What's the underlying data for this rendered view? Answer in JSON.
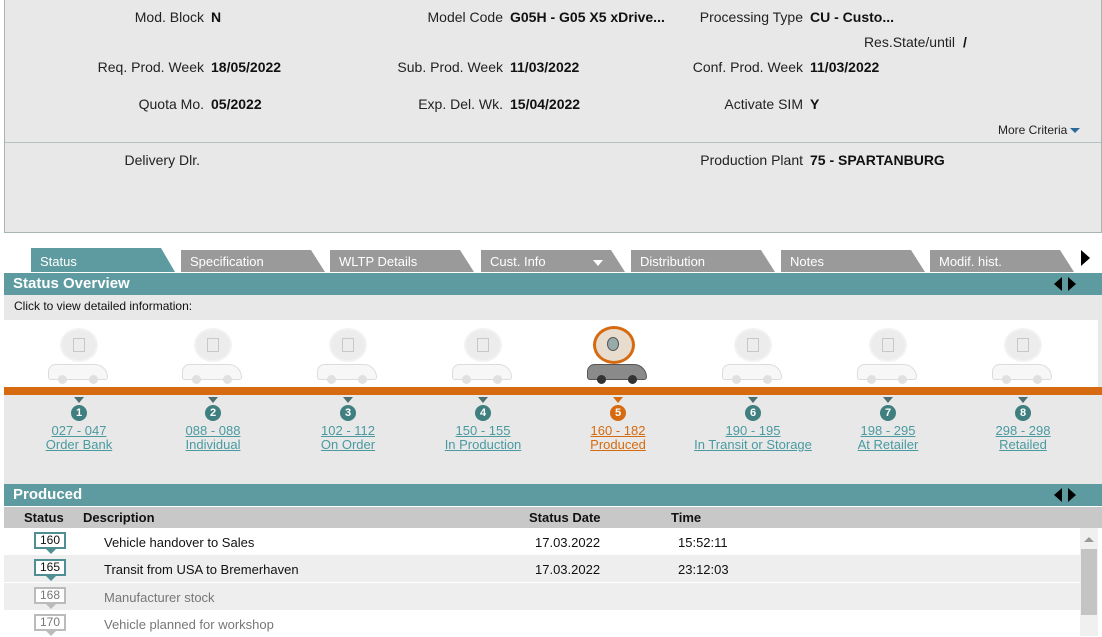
{
  "header": {
    "mod_block": {
      "label": "Mod. Block",
      "value": "N"
    },
    "model_code": {
      "label": "Model Code",
      "value": "G05H - G05 X5 xDrive..."
    },
    "processing_type": {
      "label": "Processing Type",
      "value": "CU - Custo..."
    },
    "res_state": {
      "label": "Res.State/until",
      "value": "/"
    },
    "req_prod_week": {
      "label": "Req. Prod. Week",
      "value": "18/05/2022"
    },
    "sub_prod_week": {
      "label": "Sub. Prod. Week",
      "value": "11/03/2022"
    },
    "conf_prod_week": {
      "label": "Conf. Prod. Week",
      "value": "11/03/2022"
    },
    "quota_mo": {
      "label": "Quota Mo.",
      "value": "05/2022"
    },
    "exp_del_wk": {
      "label": "Exp. Del. Wk.",
      "value": "15/04/2022"
    },
    "activate_sim": {
      "label": "Activate SIM",
      "value": "Y"
    },
    "more_criteria": "More Criteria",
    "delivery_dlr": {
      "label": "Delivery Dlr.",
      "value": ""
    },
    "production_plant": {
      "label": "Production Plant",
      "value": "75 - SPARTANBURG"
    }
  },
  "tabs": [
    {
      "label": "Status",
      "active": true
    },
    {
      "label": "Specification"
    },
    {
      "label": "WLTP Details"
    },
    {
      "label": "Cust. Info",
      "dropdown": true
    },
    {
      "label": "Distribution"
    },
    {
      "label": "Notes"
    },
    {
      "label": "Modif. hist."
    }
  ],
  "status_overview": {
    "title": "Status Overview",
    "hint": "Click to view detailed information:",
    "steps": [
      {
        "num": "1",
        "range": "027 - 047",
        "name": "Order Bank",
        "icon": "question-doc-icon"
      },
      {
        "num": "2",
        "range": "088 - 088",
        "name": "Individual",
        "icon": "checklist-icon"
      },
      {
        "num": "3",
        "range": "102 - 112",
        "name": "On Order",
        "icon": "calendar-icon"
      },
      {
        "num": "4",
        "range": "150 - 155",
        "name": "In Production",
        "icon": "conveyor-icon"
      },
      {
        "num": "5",
        "range": "160 - 182",
        "name": "Produced",
        "icon": "globe-car-icon",
        "current": true
      },
      {
        "num": "6",
        "range": "190 - 195",
        "name": "In Transit or Storage",
        "icon": "wrench-icon"
      },
      {
        "num": "7",
        "range": "198 - 295",
        "name": "At Retailer",
        "icon": "cars-icon"
      },
      {
        "num": "8",
        "range": "298 - 298",
        "name": "Retailed",
        "icon": "handshake-icon"
      }
    ]
  },
  "produced": {
    "title": "Produced",
    "columns": {
      "status": "Status",
      "description": "Description",
      "date": "Status Date",
      "time": "Time"
    },
    "rows": [
      {
        "code": "160",
        "description": "Vehicle handover to Sales",
        "date": "17.03.2022",
        "time": "15:52:11"
      },
      {
        "code": "165",
        "description": "Transit from USA to Bremerhaven",
        "date": "17.03.2022",
        "time": "23:12:03"
      },
      {
        "code": "168",
        "description": "Manufacturer stock",
        "date": "",
        "time": ""
      },
      {
        "code": "170",
        "description": "Vehicle planned for workshop",
        "date": "",
        "time": ""
      }
    ]
  },
  "colors": {
    "accent": "#5e9ba0",
    "current": "#d66a10",
    "tab_inactive": "#9a9a9a"
  }
}
